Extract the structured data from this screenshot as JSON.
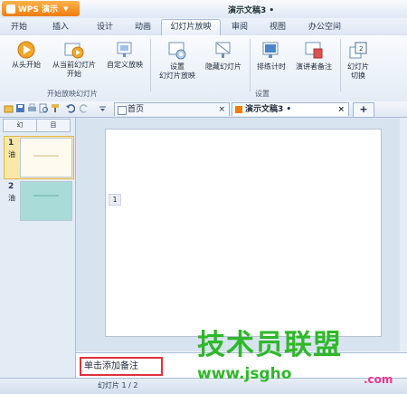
{
  "app": {
    "logo_label": "WPS 演示",
    "document_title": "演示文稿3 •"
  },
  "tabs": [
    "开始",
    "插入",
    "设计",
    "动画",
    "幻灯片放映",
    "审阅",
    "视图",
    "办公空间"
  ],
  "ribbon": {
    "buttons": {
      "from_start": "从头开始",
      "from_current_1": "从当前幻灯片",
      "from_current_2": "开始",
      "custom_show": "自定义放映",
      "setup_1": "设置",
      "setup_2": "幻灯片放映",
      "hide_slide": "隐藏幻灯片",
      "rehearse": "排练计时",
      "presenter_notes": "演讲者备注",
      "switch_1": "幻灯片",
      "switch_2": "切换"
    },
    "groups": {
      "start_show": "开始放映幻灯片",
      "setup": "设置"
    }
  },
  "document_tabs": [
    {
      "label": "首页",
      "close": "×"
    },
    {
      "label": "演示文稿3 •",
      "close": "×"
    }
  ],
  "new_tab": "+",
  "left_panel": {
    "tabs": [
      "幻",
      "目"
    ],
    "slides": [
      {
        "number": "1",
        "prefix": "油"
      },
      {
        "number": "2",
        "prefix": "油"
      }
    ]
  },
  "slide": {
    "marker": "1"
  },
  "notes": {
    "placeholder": "单击添加备注"
  },
  "status": {
    "slide_indicator": "幻灯片 1 / 2"
  },
  "watermark": {
    "site_cn": "技术员联盟",
    "site_url": "www.jsgho",
    "site_tld": ".com"
  },
  "colors": {
    "accent_orange": "#f07d0a",
    "notes_highlight": "#e0323a",
    "watermark_green": "#2fb829"
  }
}
